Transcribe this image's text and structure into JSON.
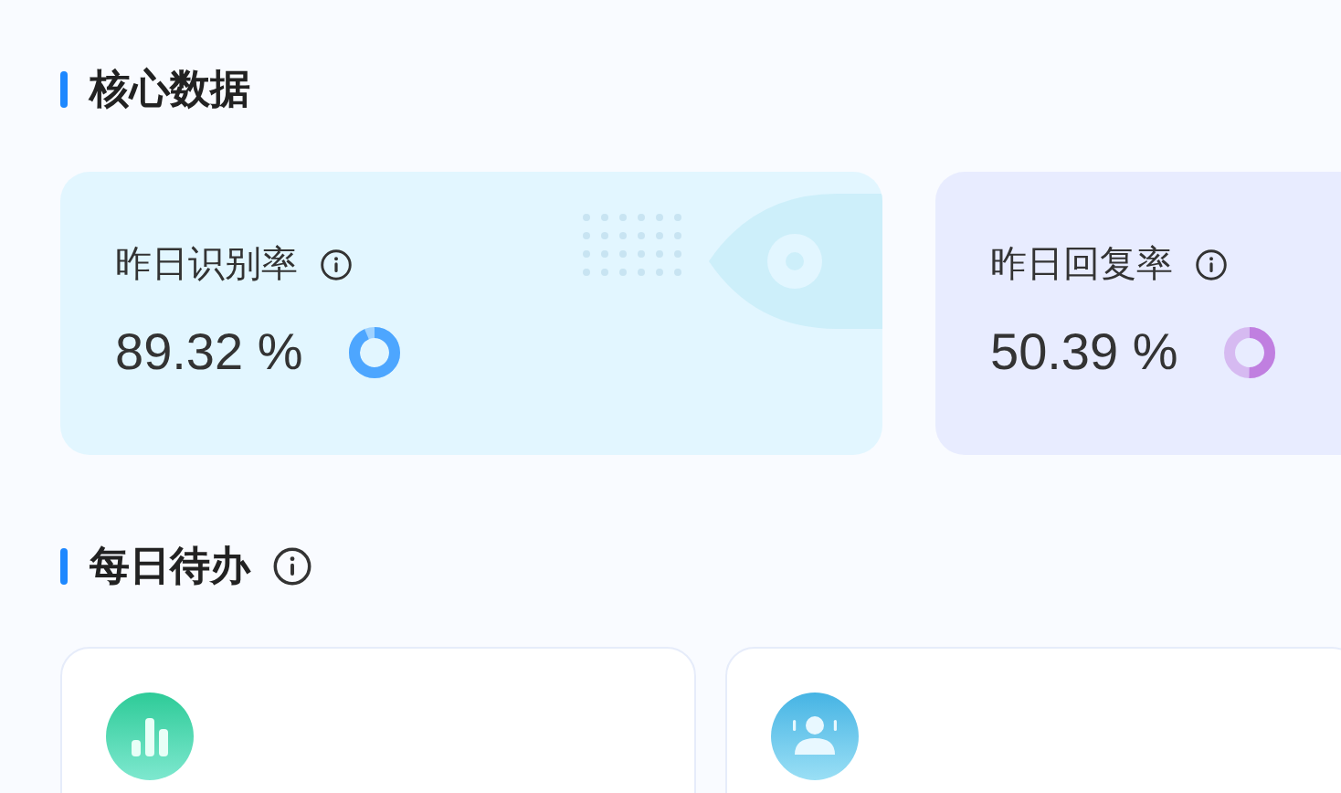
{
  "sections": [
    {
      "title": "核心数据",
      "info": false,
      "stat_cards": [
        {
          "label": "昨日识别率",
          "value": "89.32 %",
          "color": "#4da6ff",
          "kind": "eye"
        },
        {
          "label": "昨日回复率",
          "value": "50.39 %",
          "color": "#c07fe0",
          "kind": "plain"
        }
      ]
    },
    {
      "title": "每日待办",
      "info": true,
      "todo_cards": [
        {
          "kind": "chart"
        },
        {
          "kind": "person"
        }
      ]
    }
  ]
}
